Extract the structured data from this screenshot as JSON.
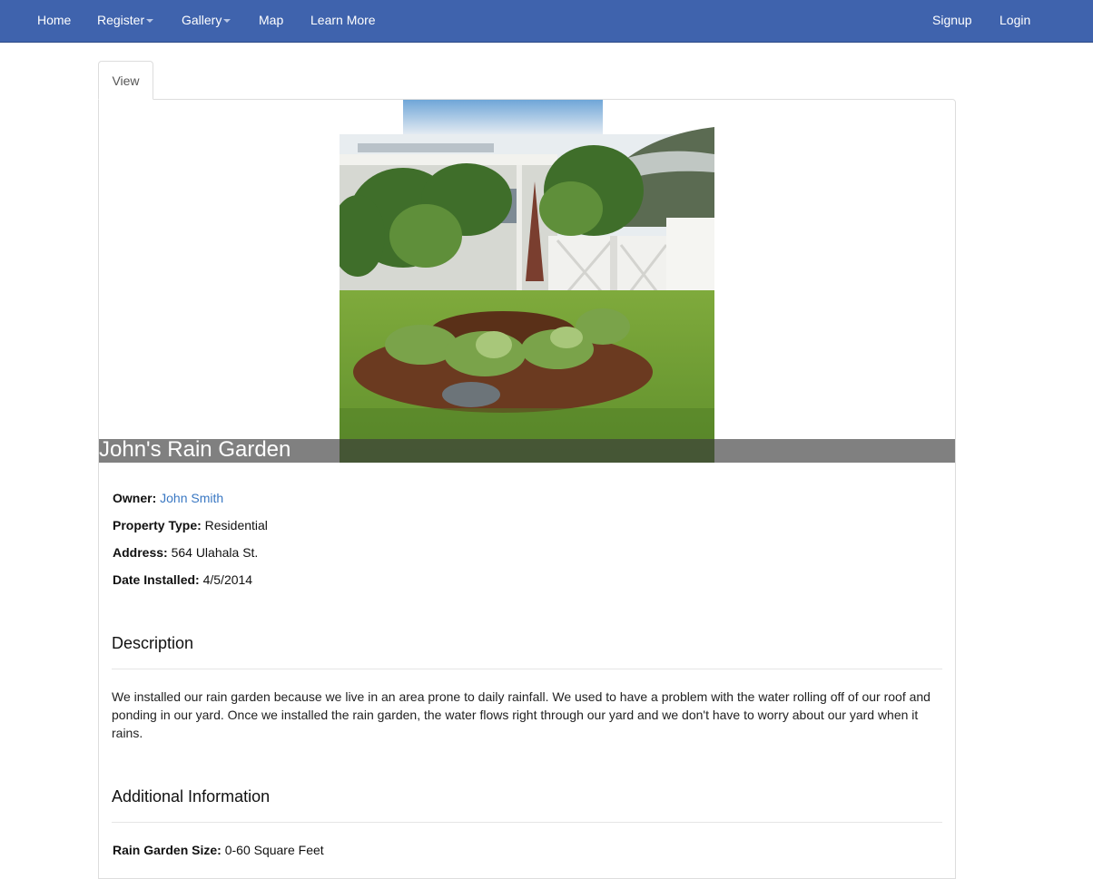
{
  "nav": {
    "home": "Home",
    "register": "Register",
    "gallery": "Gallery",
    "map": "Map",
    "learn_more": "Learn More",
    "signup": "Signup",
    "login": "Login"
  },
  "tabs": {
    "view": "View"
  },
  "garden": {
    "title": "John's Rain Garden",
    "owner_label": "Owner:",
    "owner_value": "John Smith",
    "property_type_label": "Property Type:",
    "property_type_value": "Residential",
    "address_label": "Address:",
    "address_value": "564 Ulahala St.",
    "date_label": "Date Installed:",
    "date_value": "4/5/2014"
  },
  "description": {
    "heading": "Description",
    "text": "We installed our rain garden because we live in an area prone to daily rainfall. We used to have a problem with the water rolling off of our roof and ponding in our yard. Once we installed the rain garden, the water flows right through our yard and we don't have to worry about our yard when it rains."
  },
  "additional": {
    "heading": "Additional Information",
    "size_label": "Rain Garden Size:",
    "size_value": "0-60 Square Feet"
  }
}
